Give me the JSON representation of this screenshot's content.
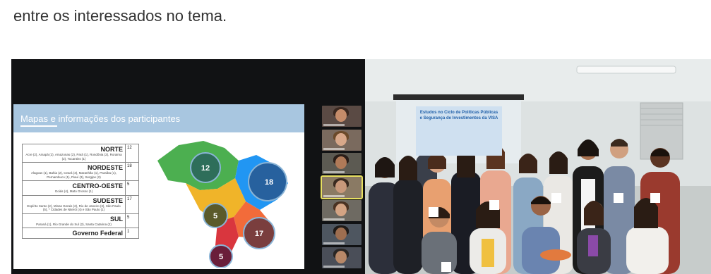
{
  "article": {
    "text": "entre os interessados no tema."
  },
  "video_call": {
    "slide_title": "Mapas e informações dos participantes",
    "regions": [
      {
        "name": "NORTE",
        "count": "12",
        "states": "Acre (2), Amapá (2), Amazonas (2), Pará (1), Rondônia (2), Roraima (2), Tocantins (1)"
      },
      {
        "name": "NORDESTE",
        "count": "18",
        "states": "Alagoas (1), Bahia (2), Ceará (3), Maranhão (1), Paraíba (1), Pernambuco (1), Piauí (3), Sergipe (2)"
      },
      {
        "name": "CENTRO-OESTE",
        "count": "5",
        "states": "Goiás (4), Mato Grosso (1)"
      },
      {
        "name": "SUDESTE",
        "count": "17",
        "states": "Espírito Santo (2), Minas Gerais (2), Rio de Janeiro (3), São Paulo (5), * Cidades de Niterói (4) e São Paulo (1)"
      },
      {
        "name": "SUL",
        "count": "5",
        "states": "Paraná (1), Rio Grande do Sul (2), Santa Catarina (2)"
      },
      {
        "name": "Governo Federal",
        "count": "1",
        "states": ""
      }
    ],
    "map_bubbles": [
      "12",
      "18",
      "5",
      "17",
      "5"
    ],
    "participant_thumbnails": 7
  },
  "group_photo": {
    "projection_text": "Estudos no Ciclo de Políticas Públicas e Segurança de Investimentos da VISA"
  },
  "colors": {
    "slide_header": "#a8c6e0",
    "map_north": "#4caf50",
    "map_northeast": "#2196f3",
    "map_centerwest": "#f0b429",
    "map_southeast": "#f26b3a",
    "map_south": "#d9363e"
  }
}
